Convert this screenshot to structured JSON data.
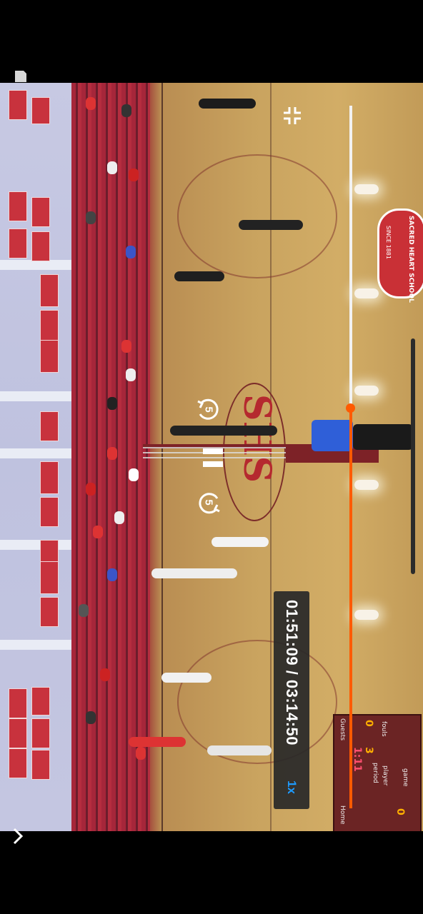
{
  "player": {
    "current_time": "01:51:09",
    "total_time": "03:14:50",
    "time_separator": " / ",
    "playback_speed": "1x",
    "progress_fraction": 0.57,
    "skip_back_seconds": "5",
    "skip_forward_seconds": "5"
  },
  "scene": {
    "court_text": "SHS",
    "logo_text": "SACRED HEART SCHOOL",
    "logo_subtext": "SINCE 1881",
    "scoreboard": {
      "home_label": "Home",
      "guests_label": "Guests",
      "period_label": "period",
      "player_label": "player",
      "fouls_label": "fouls",
      "game_label": "game",
      "clock": "1:11",
      "period": "3",
      "home_score": "0",
      "guests_score": "0"
    }
  },
  "colors": {
    "accent": "#ff5a00",
    "speed": "#1e9bff",
    "track": "#f2f2f2"
  },
  "icons": [
    "collapse-icon",
    "pause-icon",
    "skip-back-icon",
    "skip-forward-icon",
    "chevron-right-icon",
    "status-icon"
  ]
}
